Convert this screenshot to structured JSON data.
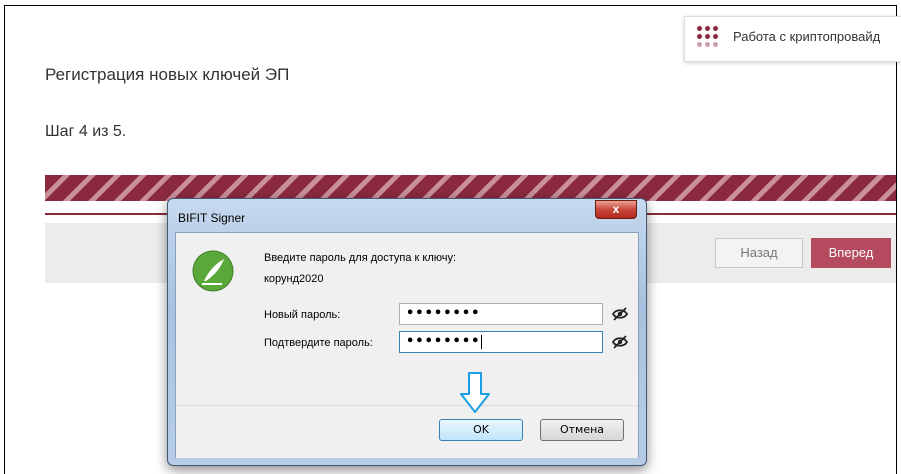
{
  "page": {
    "title": "Регистрация новых ключей ЭП",
    "step": "Шаг 4 из 5.",
    "crypto_link_label": "Работа с криптопровайд",
    "back_label": "Назад",
    "next_label": "Вперед",
    "colors": {
      "accent": "#8b2a3e",
      "next_button": "#b5495e"
    }
  },
  "dialog": {
    "title": "BIFIT Signer",
    "close_label": "x",
    "prompt": "Введите пароль для доступа к ключу:",
    "key_name": "корунд2020",
    "new_password_label": "Новый пароль:",
    "new_password_value": "••••••••",
    "confirm_password_label": "Подтвердите пароль:",
    "confirm_password_value": "••••••••",
    "ok_label": "OK",
    "cancel_label": "Отмена",
    "icons": [
      "bifit-signer-logo-icon",
      "eye-hidden-icon",
      "down-arrow-icon"
    ]
  }
}
